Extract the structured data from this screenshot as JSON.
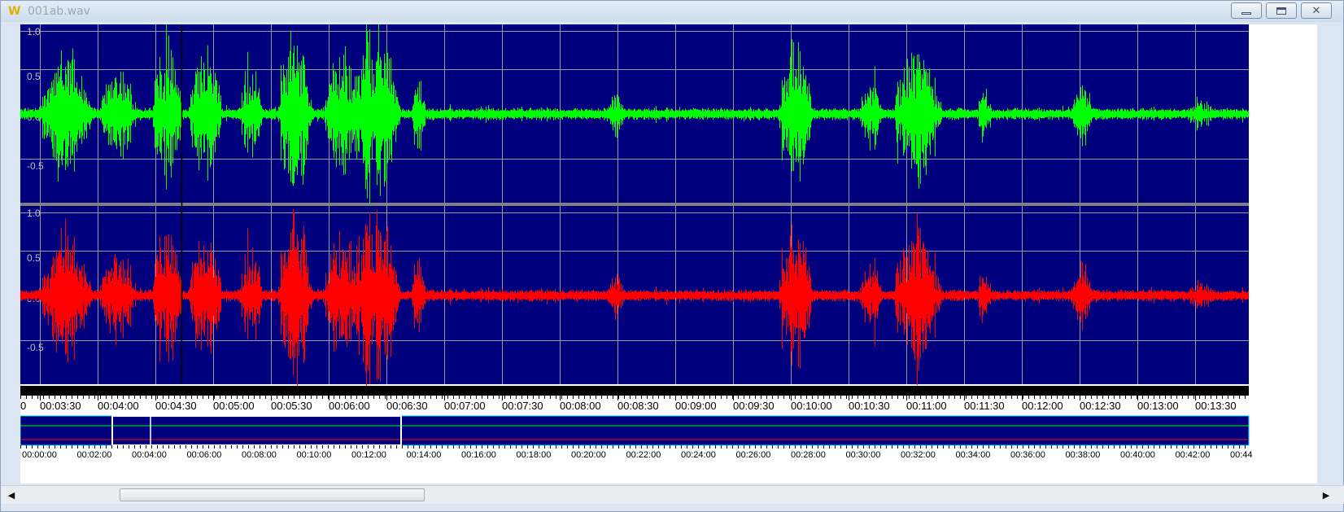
{
  "window": {
    "title": "001ab.wav",
    "app_icon": "W",
    "icons": {
      "app": "wave-app-icon",
      "minimize": "minimize-icon",
      "maximize": "maximize-icon",
      "close": "close-icon"
    }
  },
  "colors": {
    "plot_background": "#00007f",
    "channel_top": "#00ff00",
    "channel_bottom": "#ff0000",
    "grid": "#9a9a9a",
    "cursor": "#000000",
    "separator": "#808080"
  },
  "channels": [
    {
      "name": "top",
      "y_labels": [
        "1.0",
        "0.5",
        "0.0",
        "-0.5"
      ]
    },
    {
      "name": "bottom",
      "y_labels": [
        "1.0",
        "0.5",
        "0.0",
        "-0.5"
      ]
    }
  ],
  "time_axis": {
    "first_label": "0",
    "labels": [
      "00:03:30",
      "00:04:00",
      "00:04:30",
      "00:05:00",
      "00:05:30",
      "00:06:00",
      "00:06:30",
      "00:07:00",
      "00:07:30",
      "00:08:00",
      "00:08:30",
      "00:09:00",
      "00:09:30",
      "00:10:00",
      "00:10:30",
      "00:11:00",
      "00:11:30",
      "00:12:00",
      "00:12:30",
      "00:13:00",
      "00:13:30"
    ]
  },
  "overview": {
    "labels": [
      "00:00:00",
      "00:02:00",
      "00:04:00",
      "00:06:00",
      "00:08:00",
      "00:10:00",
      "00:12:00",
      "00:14:00",
      "00:16:00",
      "00:18:00",
      "00:20:00",
      "00:22:00",
      "00:24:00",
      "00:26:00",
      "00:28:00",
      "00:30:00",
      "00:32:00",
      "00:34:00",
      "00:36:00",
      "00:38:00",
      "00:40:00",
      "00:42:00",
      "00:44"
    ]
  },
  "scrollbar": {
    "left_arrow": "◀",
    "right_arrow": "▶"
  }
}
